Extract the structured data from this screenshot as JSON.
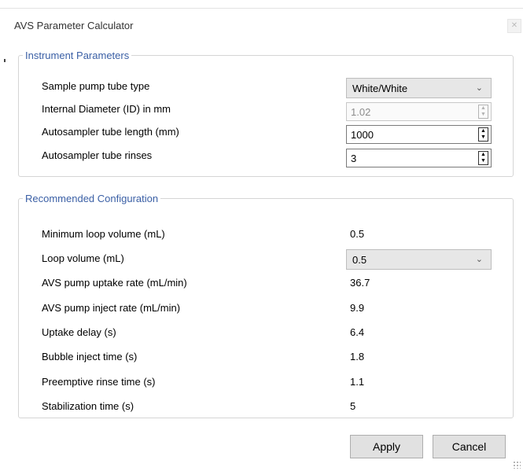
{
  "window": {
    "title": "AVS Parameter Calculator"
  },
  "instrument": {
    "legend": "Instrument Parameters",
    "pump_tube_label": "Sample pump tube type",
    "pump_tube_value": "White/White",
    "id_label": "Internal Diameter (ID) in mm",
    "id_value": "1.02",
    "length_label": "Autosampler tube length (mm)",
    "length_value": "1000",
    "rinses_label": "Autosampler tube rinses",
    "rinses_value": "3"
  },
  "recommended": {
    "legend": "Recommended Configuration",
    "rows": [
      {
        "label": "Minimum loop volume (mL)",
        "value": "0.5"
      },
      {
        "label": "Loop volume (mL)",
        "value": "0.5"
      },
      {
        "label": "AVS pump uptake rate (mL/min)",
        "value": "36.7"
      },
      {
        "label": "AVS pump inject rate (mL/min)",
        "value": "9.9"
      },
      {
        "label": "Uptake delay (s)",
        "value": "6.4"
      },
      {
        "label": "Bubble inject time (s)",
        "value": "1.8"
      },
      {
        "label": "Preemptive rinse time (s)",
        "value": "1.1"
      },
      {
        "label": "Stabilization time (s)",
        "value": "5"
      }
    ]
  },
  "buttons": {
    "apply": "Apply",
    "cancel": "Cancel"
  },
  "icons": {
    "chevron": "chevron-down-icon",
    "spin": "spinner-arrows-icon"
  },
  "colors": {
    "legend": "#3a5fa5",
    "combo_bg": "#e7e7e7",
    "button_bg": "#e1e1e1"
  }
}
